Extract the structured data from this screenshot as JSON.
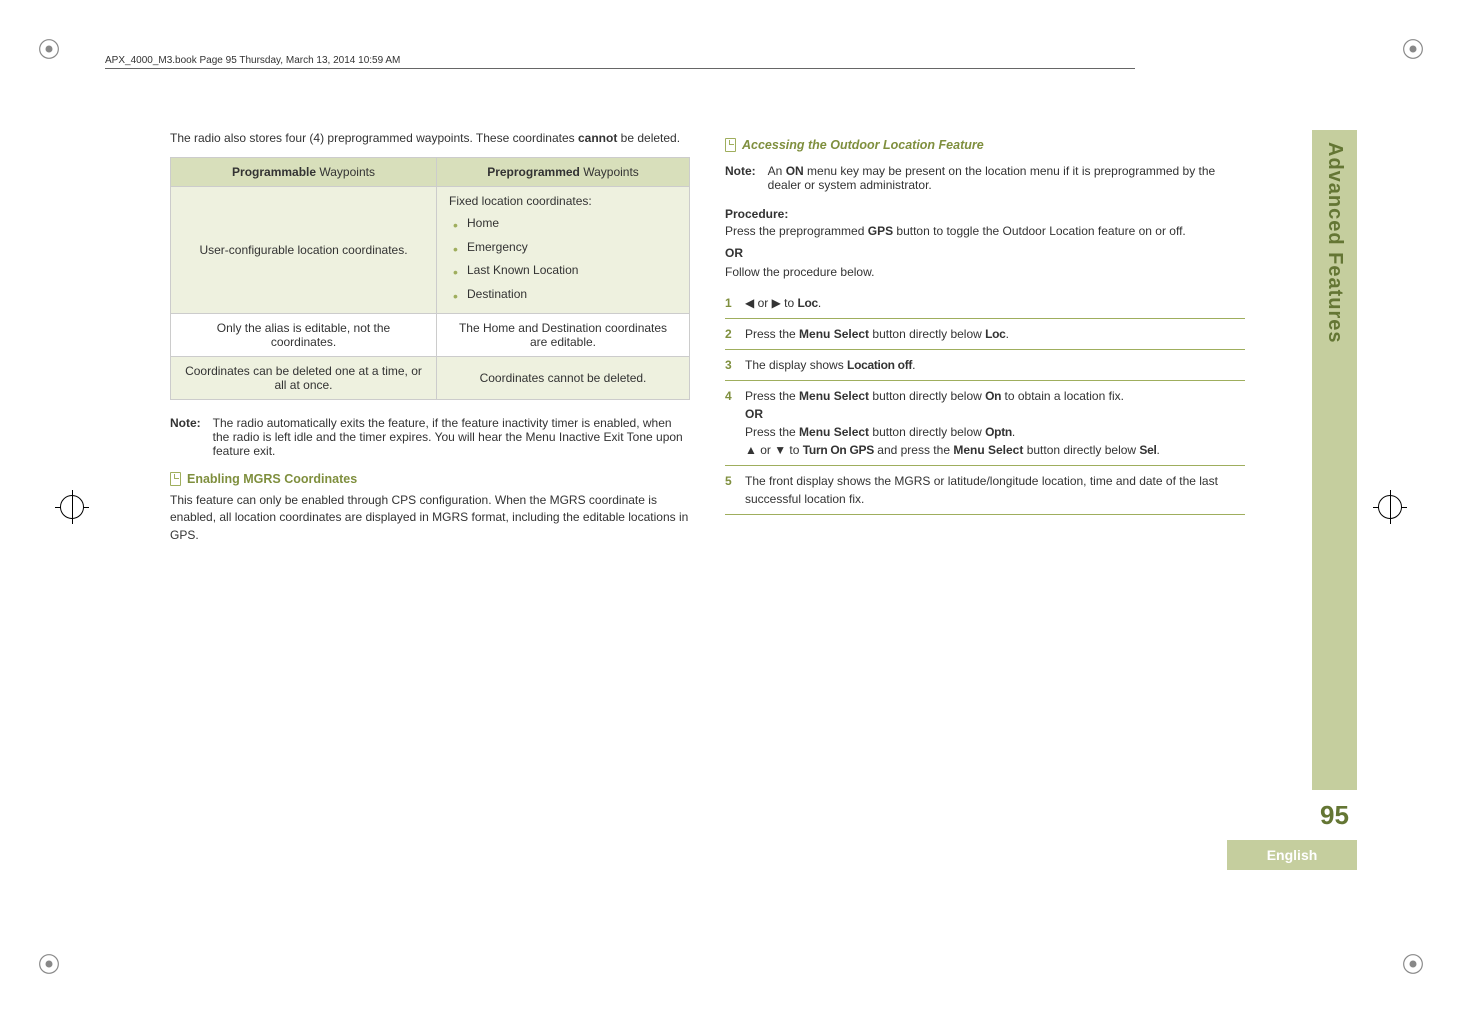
{
  "header": {
    "running_head": "APX_4000_M3.book  Page 95  Thursday, March 13, 2014  10:59 AM"
  },
  "left": {
    "intro_a": "The radio also stores four (4) preprogrammed waypoints. These coordinates ",
    "intro_bold": "cannot",
    "intro_b": " be deleted.",
    "table": {
      "head_a_prefix": "Programmable",
      "head_a_suffix": " Waypoints",
      "head_b_prefix": "Preprogrammed",
      "head_b_suffix": " Waypoints",
      "rows": [
        {
          "a": "User-configurable location coordinates.",
          "b_lead": "Fixed location coordinates:",
          "b_list": [
            "Home",
            "Emergency",
            "Last Known Location",
            "Destination"
          ],
          "alt": true
        },
        {
          "a": "Only the alias is editable, not the coordinates.",
          "b": "The Home and Destination coordinates are editable.",
          "alt": false
        },
        {
          "a": "Coordinates can be deleted one at a time, or all at once.",
          "b": "Coordinates cannot be deleted.",
          "alt": true
        }
      ]
    },
    "note1": {
      "label": "Note:",
      "text": "The radio automatically exits the feature, if the feature inactivity timer is enabled, when the radio is left idle and the timer expires. You will hear the Menu Inactive Exit Tone upon feature exit."
    },
    "h_mgrs": "Enabling MGRS Coordinates",
    "mgrs_para": "This feature can only be enabled through CPS configuration. When the MGRS coordinate is enabled, all location coordinates are displayed in MGRS format, including the editable locations in GPS."
  },
  "right": {
    "h_access": "Accessing the Outdoor Location Feature",
    "note2": {
      "label": "Note:",
      "text_a": "An ",
      "text_bold": "ON",
      "text_b": " menu key may be present on the location menu if it is preprogrammed by the dealer or system administrator."
    },
    "proc_label": "Procedure:",
    "proc_line1_a": "Press the preprogrammed ",
    "proc_line1_bold": "GPS",
    "proc_line1_b": " button to toggle the Outdoor Location feature on or off.",
    "or": "OR",
    "proc_line2": "Follow the procedure below.",
    "steps": [
      {
        "n": "1",
        "parts": [
          "◀ or ▶ to ",
          {
            "ui": "Loc"
          },
          "."
        ]
      },
      {
        "n": "2",
        "parts": [
          "Press the ",
          {
            "kbd": "Menu Select"
          },
          " button directly below ",
          {
            "ui": "Loc"
          },
          "."
        ]
      },
      {
        "n": "3",
        "parts": [
          "The display shows ",
          {
            "ui": "Location off"
          },
          "."
        ]
      },
      {
        "n": "4",
        "parts": [
          "Press the ",
          {
            "kbd": "Menu Select"
          },
          " button directly below ",
          {
            "ui": "On"
          },
          " to obtain a location fix.",
          {
            "br": true
          },
          {
            "or": "OR"
          },
          {
            "br": true
          },
          "Press the ",
          {
            "kbd": "Menu Select"
          },
          " button directly below ",
          {
            "ui": "Optn"
          },
          ".",
          {
            "br": true
          },
          "▲ or ▼ to ",
          {
            "ui": "Turn On GPS"
          },
          " and press the ",
          {
            "kbd": "Menu Select"
          },
          " button directly below ",
          {
            "ui": "Sel"
          },
          "."
        ]
      },
      {
        "n": "5",
        "parts": [
          "The front display shows the MGRS or latitude/longitude location, time and date of the last successful location fix."
        ]
      }
    ]
  },
  "side": {
    "tab": "Advanced Features",
    "page": "95",
    "lang": "English"
  }
}
